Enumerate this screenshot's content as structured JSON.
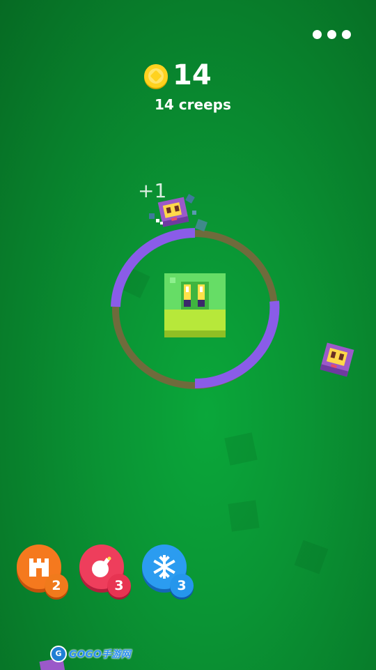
{
  "hud": {
    "score": "14",
    "creeps_label": "14 creeps",
    "hit_popup": "+1"
  },
  "menu": {
    "icon": "more-dots-icon"
  },
  "powerups": [
    {
      "name": "castle",
      "icon": "castle-icon",
      "count": "2",
      "color": "#f5791e"
    },
    {
      "name": "bomb",
      "icon": "bomb-icon",
      "count": "3",
      "color": "#ee3e5c"
    },
    {
      "name": "freeze",
      "icon": "snowflake-icon",
      "count": "3",
      "color": "#2b9cf0"
    }
  ],
  "ring": {
    "shield_color": "#8a5ce8",
    "track_color": "#6f6b3c"
  },
  "watermark": {
    "text": "GOGO手游网"
  },
  "colors": {
    "background": "#0a9434",
    "player": "#5fd65f",
    "creep": "#9b59c9"
  }
}
